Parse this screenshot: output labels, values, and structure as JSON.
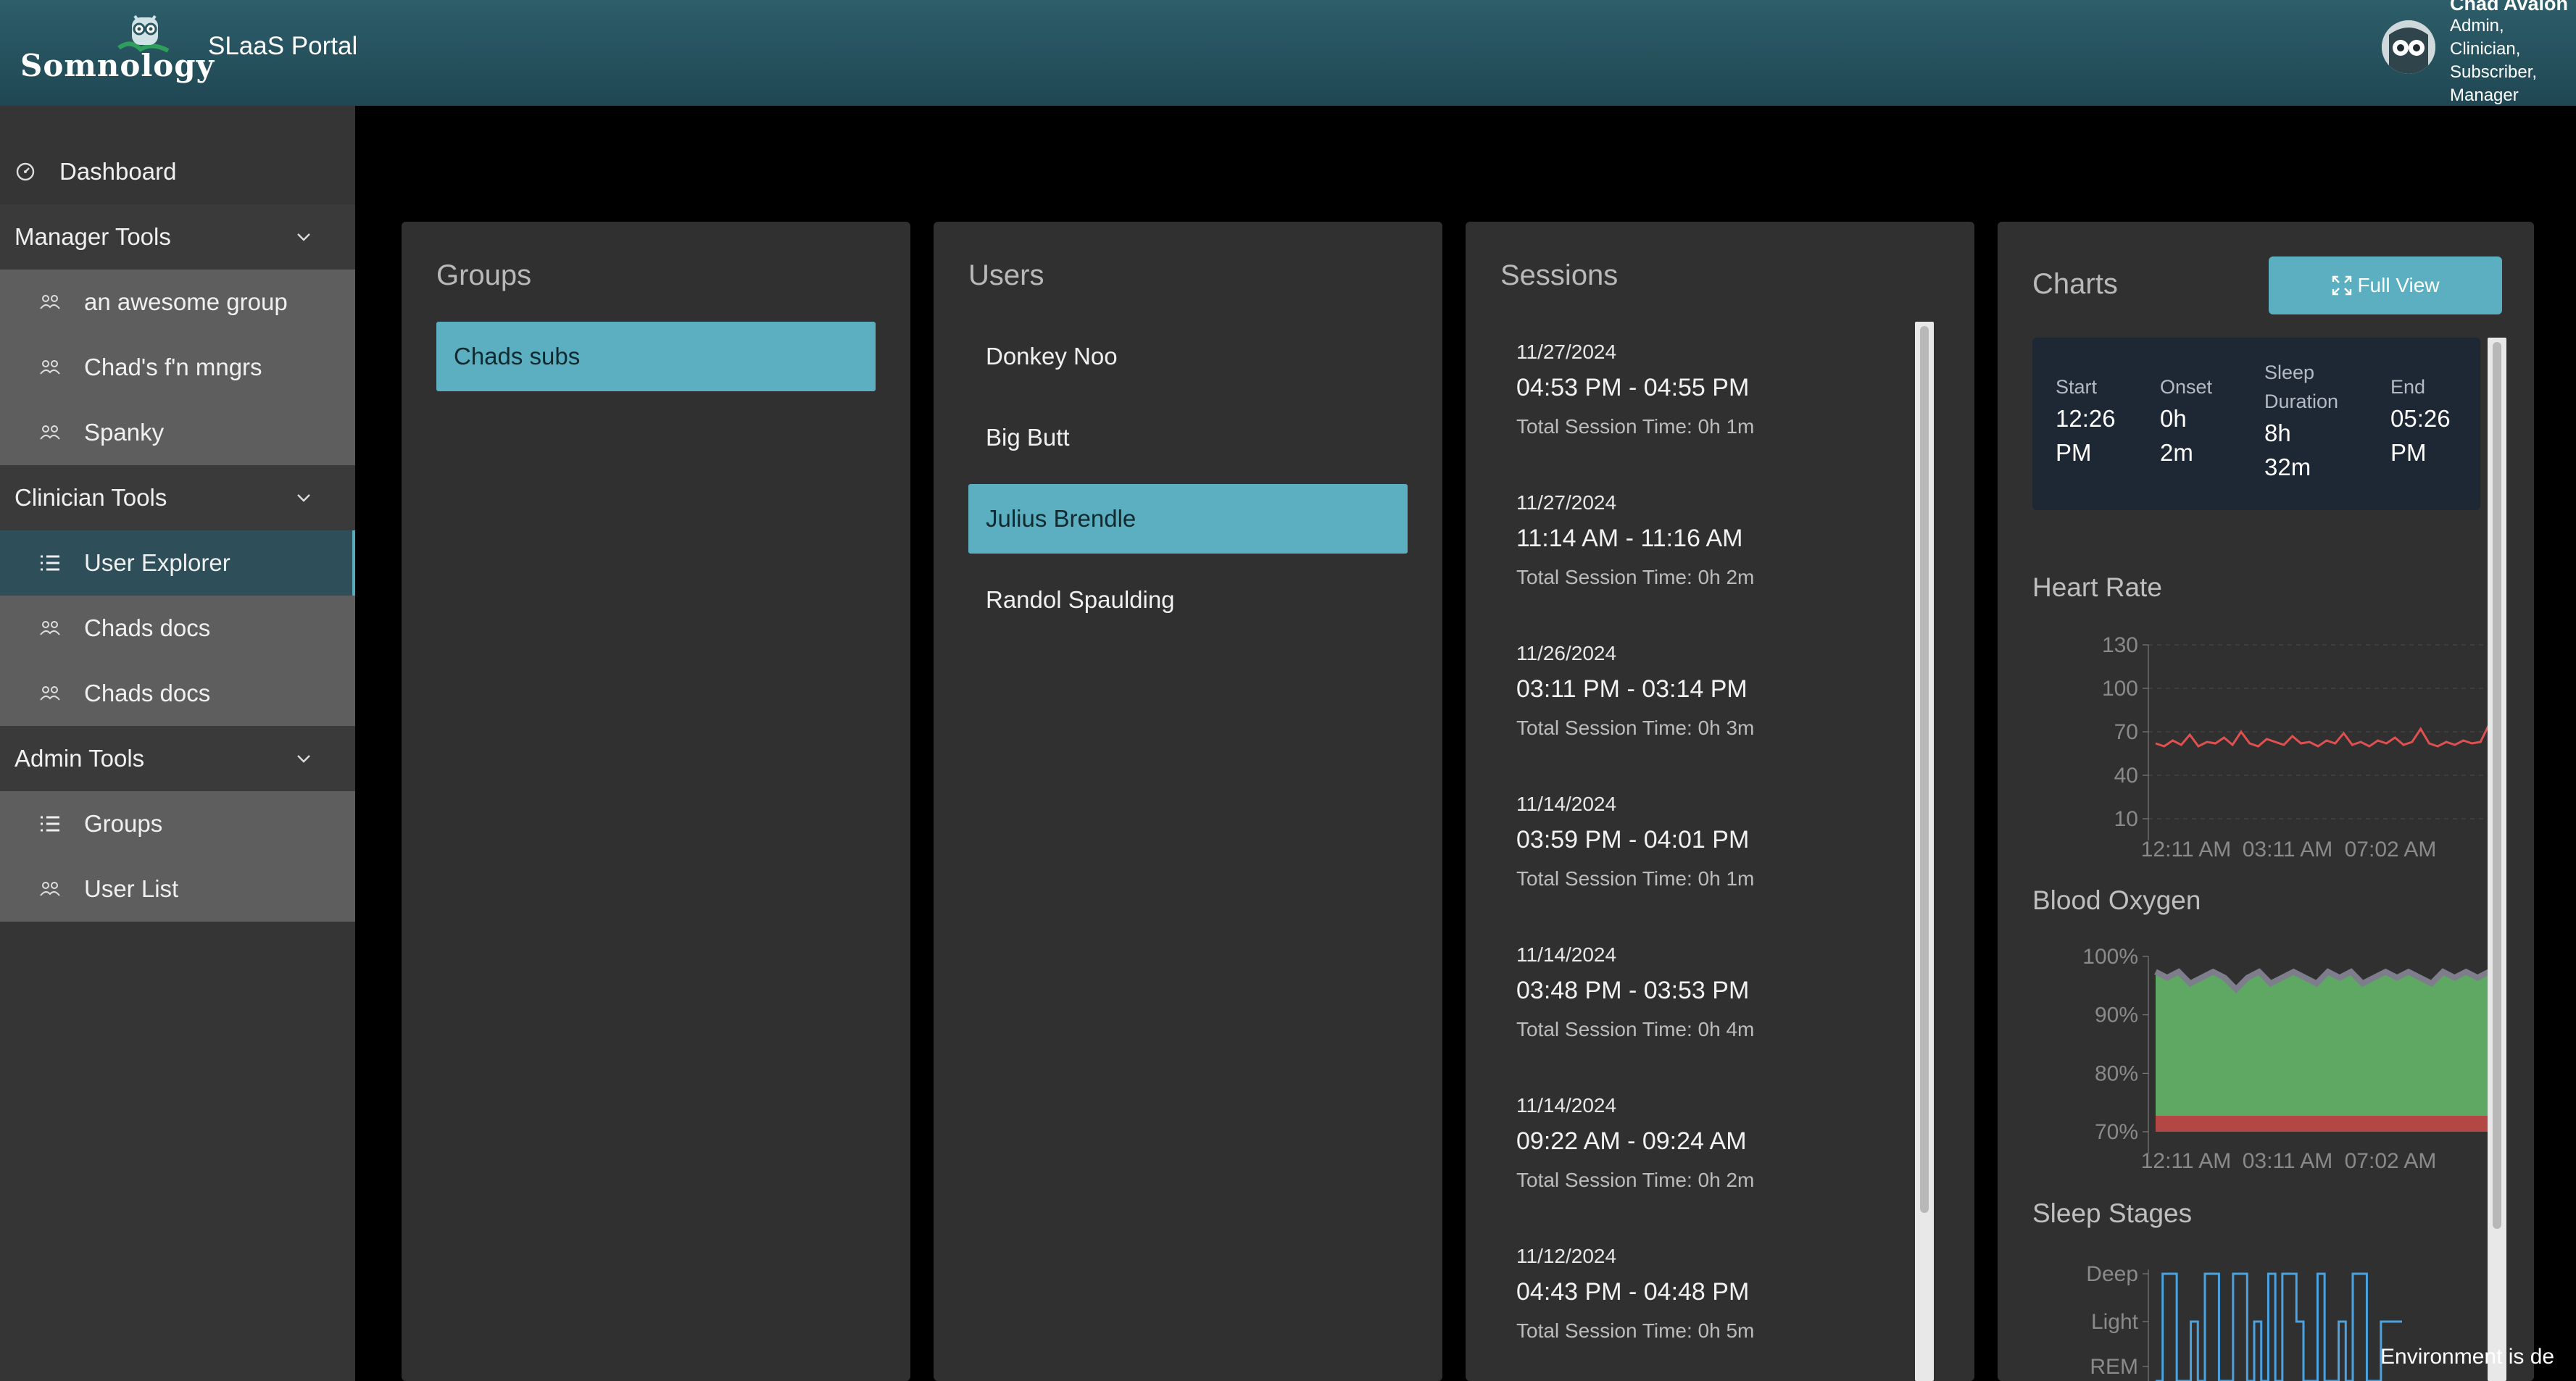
{
  "header": {
    "logo_text": "Somnology",
    "portal_title": "SLaaS Portal",
    "user_name": "Chad Avalon",
    "user_roles": [
      "Admin,",
      "Clinician,",
      "Subscriber,",
      "Manager"
    ]
  },
  "sidebar": {
    "dashboard": "Dashboard",
    "sections": [
      {
        "label": "Manager Tools",
        "items": [
          "an awesome group",
          "Chad's f'n mngrs",
          "Spanky"
        ]
      },
      {
        "label": "Clinician Tools",
        "items": [
          "User Explorer",
          "Chads docs",
          "Chads docs"
        ]
      },
      {
        "label": "Admin Tools",
        "items": [
          "Groups",
          "User List"
        ]
      }
    ]
  },
  "groups": {
    "title": "Groups",
    "items": [
      "Chads subs"
    ],
    "selected": "Chads subs"
  },
  "users": {
    "title": "Users",
    "items": [
      "Donkey Noo",
      "Big Butt",
      "Julius Brendle",
      "Randol Spaulding"
    ],
    "selected": "Julius Brendle"
  },
  "sessions": {
    "title": "Sessions",
    "items": [
      {
        "date": "11/27/2024",
        "time": "04:53 PM - 04:55 PM",
        "total": "Total Session Time: 0h 1m"
      },
      {
        "date": "11/27/2024",
        "time": "11:14 AM - 11:16 AM",
        "total": "Total Session Time: 0h 2m"
      },
      {
        "date": "11/26/2024",
        "time": "03:11 PM - 03:14 PM",
        "total": "Total Session Time: 0h 3m"
      },
      {
        "date": "11/14/2024",
        "time": "03:59 PM - 04:01 PM",
        "total": "Total Session Time: 0h 1m"
      },
      {
        "date": "11/14/2024",
        "time": "03:48 PM - 03:53 PM",
        "total": "Total Session Time: 0h 4m"
      },
      {
        "date": "11/14/2024",
        "time": "09:22 AM - 09:24 AM",
        "total": "Total Session Time: 0h 2m"
      },
      {
        "date": "11/12/2024",
        "time": "04:43 PM - 04:48 PM",
        "total": "Total Session Time: 0h 5m"
      }
    ]
  },
  "charts": {
    "title": "Charts",
    "full_view_label": "Full View",
    "summary": {
      "start_label": "Start",
      "start_value_1": "12:26",
      "start_value_2": "PM",
      "onset_label": "Onset",
      "onset_value_1": "0h",
      "onset_value_2": "2m",
      "duration_label_1": "Sleep",
      "duration_label_2": "Duration",
      "duration_value_1": "8h",
      "duration_value_2": "32m",
      "end_label": "End",
      "end_value_1": "05:26",
      "end_value_2": "PM"
    },
    "heart_rate": {
      "title": "Heart Rate",
      "y_ticks": [
        "130",
        "100",
        "70",
        "40",
        "10"
      ],
      "x_ticks": [
        "12:11 AM",
        "03:11 AM",
        "07:02 AM"
      ]
    },
    "blood_oxygen": {
      "title": "Blood Oxygen",
      "y_ticks": [
        "100%",
        "90%",
        "80%",
        "70%"
      ],
      "x_ticks": [
        "12:11 AM",
        "03:11 AM",
        "07:02 AM"
      ]
    },
    "sleep_stages": {
      "title": "Sleep Stages",
      "y_ticks": [
        "Deep",
        "Light",
        "REM"
      ]
    }
  },
  "chart_data": [
    {
      "type": "line",
      "title": "Heart Rate",
      "ylim": [
        10,
        130
      ],
      "x_ticks": [
        "12:11 AM",
        "03:11 AM",
        "07:02 AM"
      ],
      "series": [
        {
          "values": [
            62,
            60,
            64,
            61,
            68,
            60,
            63,
            62,
            66,
            61,
            70,
            62,
            60,
            65,
            63,
            61,
            67,
            62,
            63,
            60,
            64,
            62,
            69,
            61,
            63,
            60,
            64,
            62,
            66,
            61,
            63,
            72,
            62,
            60,
            63,
            61,
            64,
            62,
            63,
            75
          ]
        }
      ],
      "color": "#e05050"
    },
    {
      "type": "area",
      "title": "Blood Oxygen",
      "ylim": [
        70,
        100
      ],
      "x_ticks": [
        "12:11 AM",
        "03:11 AM",
        "07:02 AM"
      ],
      "series": [
        {
          "values": [
            97,
            96,
            97,
            95,
            96,
            97,
            96,
            94,
            96,
            97,
            95,
            96,
            97,
            96,
            95,
            97,
            96,
            97,
            95,
            96,
            97,
            96,
            97,
            96,
            95,
            97,
            96,
            97,
            96,
            97
          ]
        }
      ],
      "color": "#5fa863"
    },
    {
      "type": "line",
      "title": "Sleep Stages",
      "categories": [
        "Deep",
        "Light",
        "REM"
      ],
      "color": "#4aa3e0"
    }
  ],
  "footer": {
    "env_note": "Environment is de"
  },
  "colors": {
    "accent": "#5bafc1",
    "header": "#2a5561",
    "panel": "#303030",
    "sidebar": "#353535"
  }
}
